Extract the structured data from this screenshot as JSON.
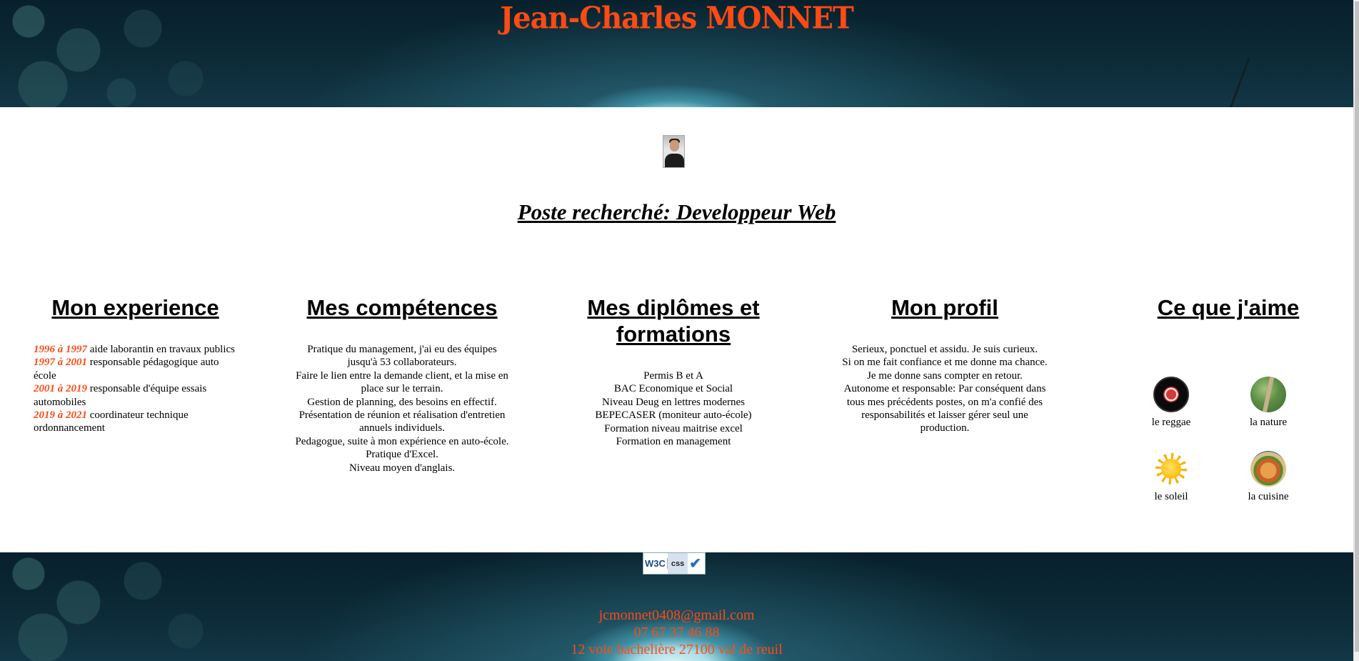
{
  "header": {
    "title": "Jean-Charles MONNET"
  },
  "job": {
    "title": "Poste recherché: Developpeur Web"
  },
  "experience": {
    "heading": "Mon experience",
    "items": [
      {
        "years": "1996 à 1997",
        "text": " aide laborantin en travaux publics"
      },
      {
        "years": "1997 à 2001",
        "text": " responsable pédagogique auto école"
      },
      {
        "years": "2001 à 2019",
        "text": " responsable d'équipe essais automobiles"
      },
      {
        "years": "2019 à 2021",
        "text": " coordinateur technique ordonnancement"
      }
    ]
  },
  "competences": {
    "heading": "Mes compétences",
    "lines": [
      "Pratique du management, j'ai eu des équipes jusqu'à 53 collaborateurs.",
      "Faire le lien entre la demande client, et la mise en place sur le terrain.",
      "Gestion de planning, des besoins en effectif.",
      "Présentation de réunion et réalisation d'entretien annuels individuels.",
      "Pedagogue, suite à mon expérience en auto-école.",
      "Pratique d'Excel.",
      "Niveau moyen d'anglais."
    ]
  },
  "diplomes": {
    "heading": "Mes diplômes et formations",
    "lines": [
      "Permis B et A",
      "BAC Economique et Social",
      "Niveau Deug en lettres modernes",
      "BEPECASER (moniteur auto-école)",
      "Formation niveau maitrise excel",
      "Formation en management"
    ]
  },
  "profil": {
    "heading": "Mon profil",
    "lines": [
      "Serieux, ponctuel et assidu. Je suis curieux.",
      "Si on me fait confiance et me donne ma chance.",
      "Je me donne sans compter en retour.",
      "Autonome et responsable: Par conséquent dans",
      "tous mes précédents postes, on m'a confié des responsabilités et laisser gérer seul une production."
    ]
  },
  "likes": {
    "heading": "Ce que j'aime",
    "items": [
      {
        "label": "le reggae",
        "icon": "reggae-icon"
      },
      {
        "label": "la nature",
        "icon": "nature-icon"
      },
      {
        "label": "le soleil",
        "icon": "sun-icon"
      },
      {
        "label": "la cuisine",
        "icon": "cuisine-icon"
      }
    ]
  },
  "footer": {
    "badge_left": "W3C",
    "badge_right": "css",
    "email": "jcmonnet0408@gmail.com",
    "phone": "07 67 37 46 88",
    "address": "12 voie bachelière 27100 val de reuil"
  },
  "colors": {
    "accent": "#ff4a14",
    "banner": "#0d2b38"
  }
}
